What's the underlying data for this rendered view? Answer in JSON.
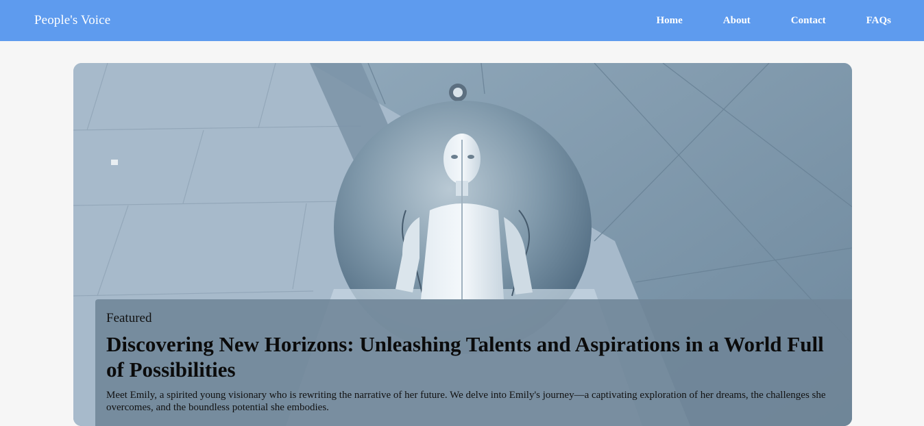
{
  "navbar": {
    "brand": "People's Voice",
    "links": [
      "Home",
      "About",
      "Contact",
      "FAQs"
    ],
    "bg_color": "#5e9bee"
  },
  "featured": {
    "tag": "Featured",
    "title": "Discovering New Horizons: Unleashing Talents and Aspirations in a World Full of Possibilities",
    "summary": "Meet Emily, a spirited young visionary who is rewriting the narrative of her future. We delve into Emily's journey—a captivating exploration of her dreams, the challenges she overcomes, and the boundless potential she embodies."
  }
}
